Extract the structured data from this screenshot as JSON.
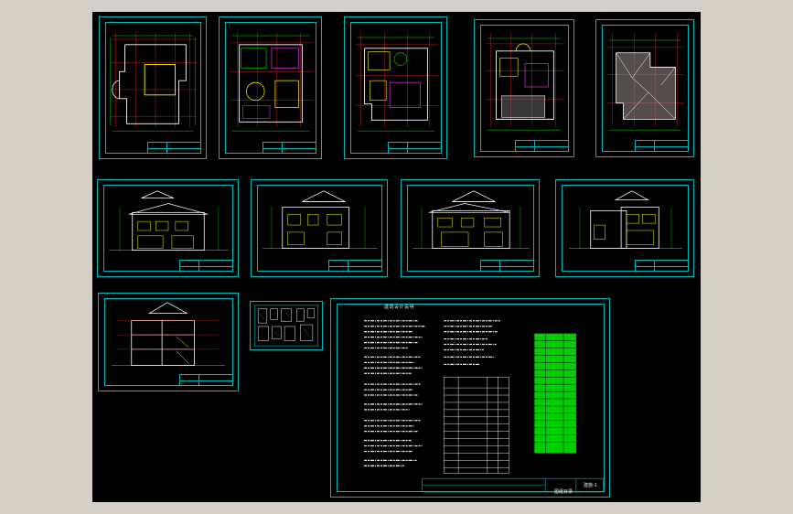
{
  "canvas": {
    "background": "#000000",
    "frame": "#d4d0c8"
  },
  "colors": {
    "border": "#00b7b7",
    "grid": "#e03030",
    "walls": "#ffffff",
    "green": "#00e000",
    "yellow": "#ffff00",
    "magenta": "#ff40ff",
    "text": "#e8e8e8"
  },
  "notes_sheet": {
    "title": "建筑设计说明",
    "drawing_label": "建施-1",
    "title_block_text": "图纸目录"
  }
}
